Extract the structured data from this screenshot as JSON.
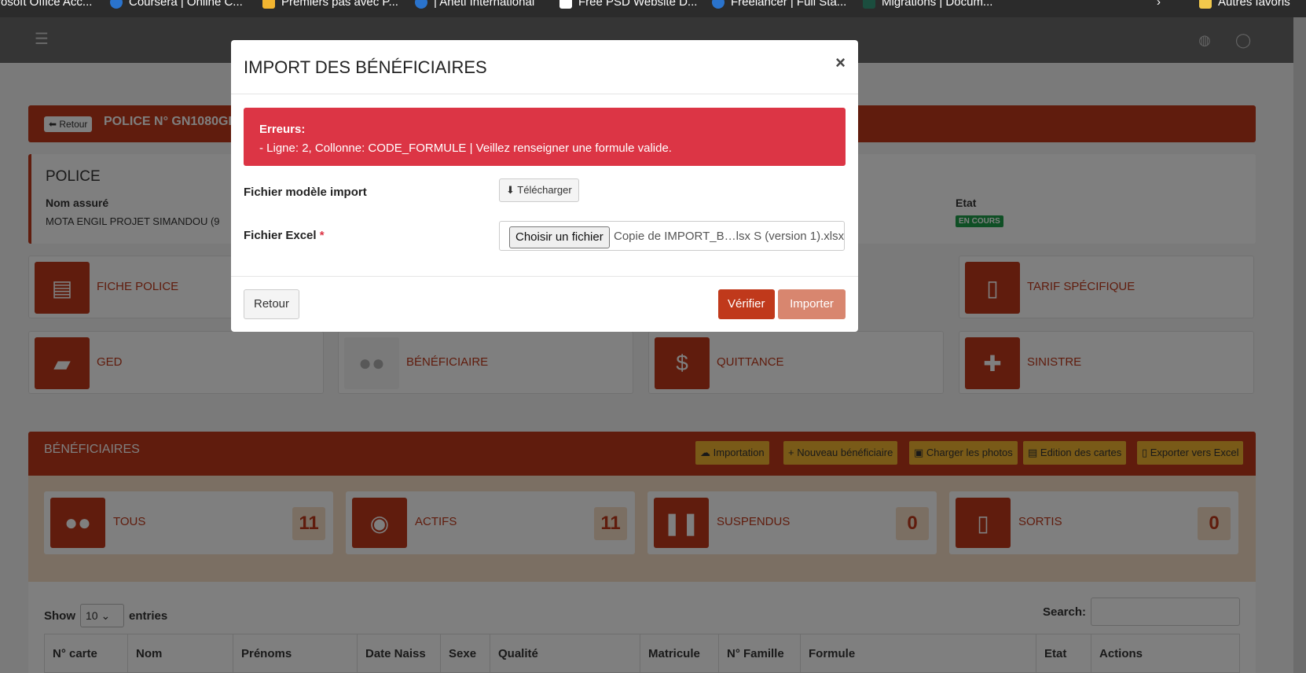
{
  "bookmarks": [
    {
      "label": "rosoft Office Acc...",
      "color": ""
    },
    {
      "label": "Coursera | Online C...",
      "color": "#2a73cc"
    },
    {
      "label": "Premiers pas avec P...",
      "color": "#f2b530"
    },
    {
      "label": "| Aneti International",
      "color": "#2a73cc"
    },
    {
      "label": "Free PSD Website D...",
      "color": "#ffffff"
    },
    {
      "label": "Freelancer | Full Sta...",
      "color": "#2a73cc"
    },
    {
      "label": "Migrations | Docum...",
      "color": "#1b4d3e"
    },
    {
      "label": "Autres favoris",
      "color": "#f2c94c"
    }
  ],
  "police": {
    "back_label": "Retour",
    "title": "POLICE N° GN1080GI",
    "section": "POLICE",
    "insured_label": "Nom assuré",
    "insured_value": "MOTA ENGIL PROJET SIMANDOU (9",
    "state_label": "Etat",
    "state_value": "EN COURS"
  },
  "tiles": [
    {
      "label": "FICHE POLICE",
      "icon": "pdf-file-icon"
    },
    {
      "label": "TARIF SPÉCIFIQUE",
      "icon": "file-icon"
    },
    {
      "label": "GED",
      "icon": "folder-icon"
    },
    {
      "label": "BÉNÉFICIAIRE",
      "icon": "users-icon"
    },
    {
      "label": "QUITTANCE",
      "icon": "invoice-icon"
    },
    {
      "label": "SINISTRE",
      "icon": "injured-person-icon"
    }
  ],
  "beneficiaires": {
    "title": "BÉNÉFICIAIRES",
    "buttons": [
      "Importation",
      "Nouveau bénéficiaire",
      "Charger les photos",
      "Edition des cartes",
      "Exporter vers Excel"
    ],
    "stats": [
      {
        "label": "TOUS",
        "count": "11",
        "icon": "users-icon"
      },
      {
        "label": "ACTIFS",
        "count": "11",
        "icon": "toggle-on-icon"
      },
      {
        "label": "SUSPENDUS",
        "count": "0",
        "icon": "pause-icon"
      },
      {
        "label": "SORTIS",
        "count": "0",
        "icon": "door-open-icon"
      }
    ]
  },
  "table": {
    "show_label": "Show",
    "entries_value": "10",
    "entries_label": "entries",
    "search_label": "Search:",
    "columns": [
      "N° carte",
      "Nom",
      "Prénoms",
      "Date Naiss",
      "Sexe",
      "Qualité",
      "Matricule",
      "N° Famille",
      "Formule",
      "Etat",
      "Actions"
    ]
  },
  "modal": {
    "title": "IMPORT DES BÉNÉFICIAIRES",
    "close": "×",
    "error_title": "Erreurs:",
    "error_message": "- Ligne: 2, Collonne: CODE_FORMULE | Veillez renseigner une formule valide.",
    "template_label": "Fichier modèle import",
    "download_label": "Télécharger",
    "excel_label": "Fichier Excel",
    "required_mark": "*",
    "choose_file_label": "Choisir un fichier",
    "file_name": "Copie de IMPORT_B…lsx S (version 1).xlsx",
    "back_button": "Retour",
    "verify_button": "Vérifier",
    "import_button": "Importer"
  },
  "colors": {
    "primary": "#c0391b",
    "danger": "#dc3545",
    "warning": "#f2b530",
    "success": "#1e9e4a"
  }
}
